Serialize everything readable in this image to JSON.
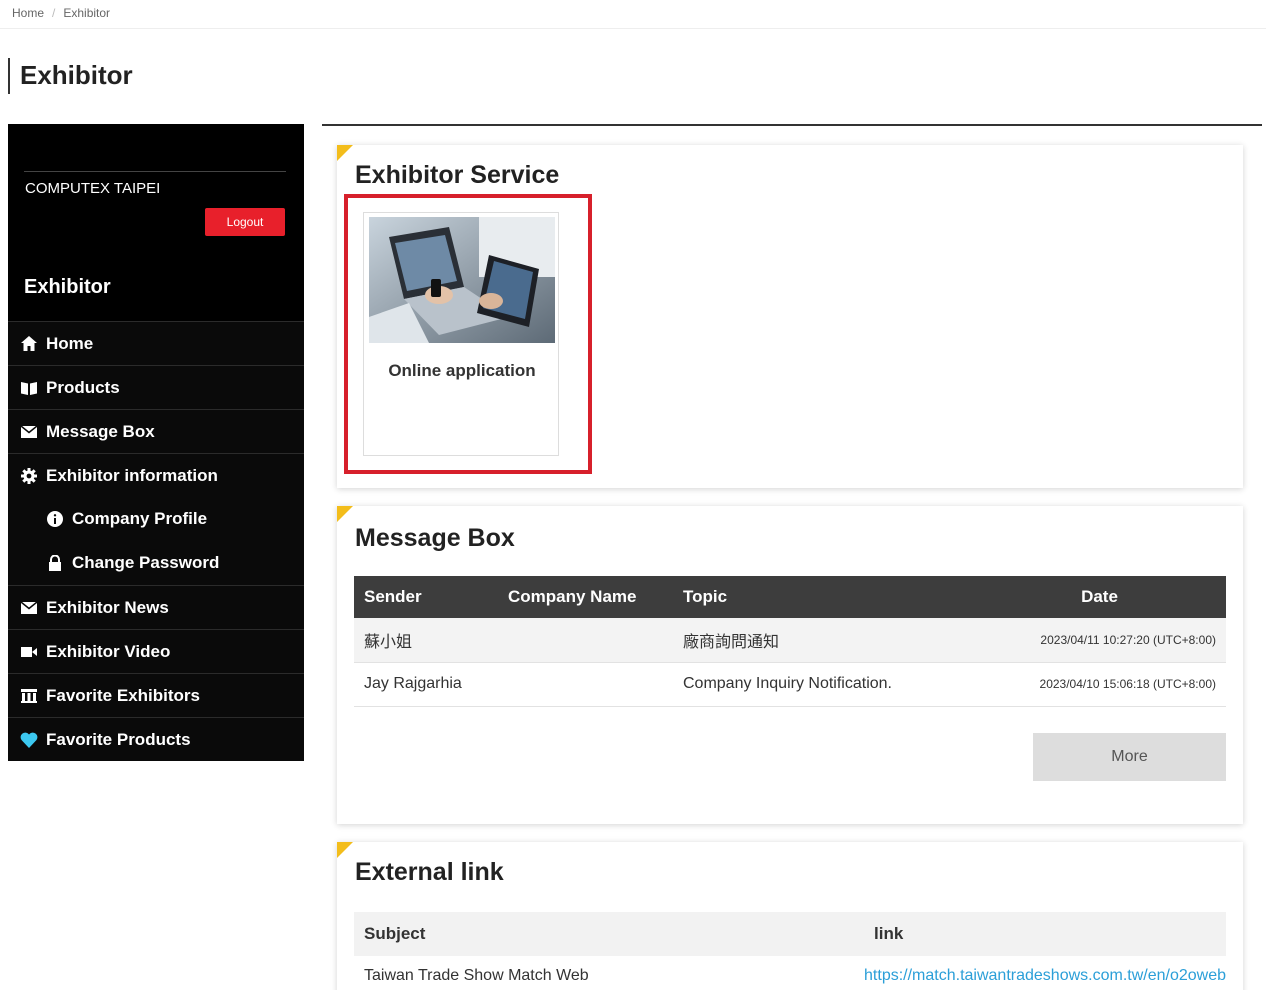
{
  "breadcrumb": {
    "home": "Home",
    "current": "Exhibitor"
  },
  "page_title": "Exhibitor",
  "sidebar": {
    "org": "COMPUTEX TAIPEI",
    "logout_label": "Logout",
    "section_title": "Exhibitor",
    "items": [
      {
        "label": "Home",
        "icon": "home-icon"
      },
      {
        "label": "Products",
        "icon": "book-icon"
      },
      {
        "label": "Message Box",
        "icon": "envelope-icon"
      },
      {
        "label": "Exhibitor information",
        "icon": "gear-icon"
      },
      {
        "label": "Company Profile",
        "icon": "info-icon"
      },
      {
        "label": "Change Password",
        "icon": "lock-icon"
      },
      {
        "label": "Exhibitor News",
        "icon": "envelope-icon"
      },
      {
        "label": "Exhibitor Video",
        "icon": "video-icon"
      },
      {
        "label": "Favorite Exhibitors",
        "icon": "building-icon"
      },
      {
        "label": "Favorite Products",
        "icon": "heart-icon"
      }
    ]
  },
  "service": {
    "title": "Exhibitor Service",
    "tile_label": "Online application"
  },
  "messages": {
    "title": "Message Box",
    "columns": [
      "Sender",
      "Company Name",
      "Topic",
      "Date"
    ],
    "rows": [
      {
        "sender": "蘇小姐",
        "company": "",
        "topic": "廠商詢問通知",
        "date": "2023/04/11 10:27:20 (UTC+8:00)"
      },
      {
        "sender": "Jay Rajgarhia",
        "company": "",
        "topic": "Company Inquiry Notification.",
        "date": "2023/04/10 15:06:18 (UTC+8:00)"
      }
    ],
    "more_label": "More"
  },
  "external": {
    "title": "External link",
    "columns": [
      "Subject",
      "link"
    ],
    "rows": [
      {
        "subject": "Taiwan Trade Show Match Web",
        "link": "https://match.taiwantradeshows.com.tw/en/o2oweb"
      }
    ]
  },
  "colors": {
    "accent": "#f3bd1b",
    "logout": "#e8202b",
    "highlight": "#d7202b",
    "link": "#2b9fd8"
  }
}
